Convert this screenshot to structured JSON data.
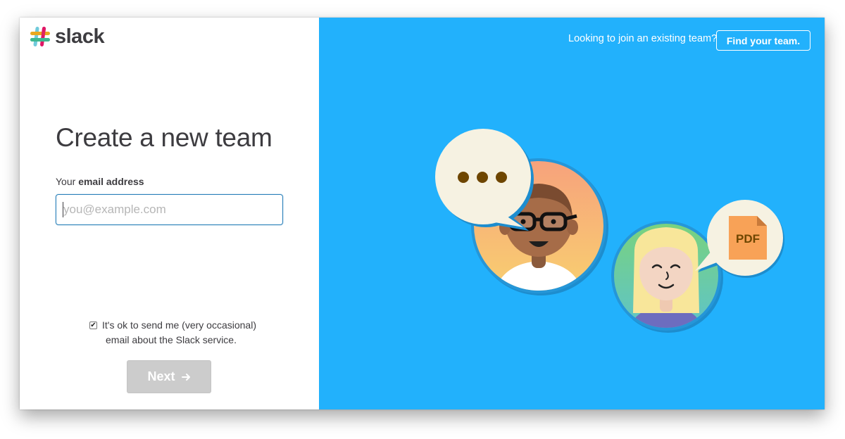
{
  "brand": {
    "name": "slack"
  },
  "form": {
    "title": "Create a new team",
    "email_label_prefix": "Your ",
    "email_label_bold": "email address",
    "email_placeholder": "you@example.com",
    "email_value": "",
    "optin_line1": "It's ok to send me (very occasional)",
    "optin_line2": "email about the Slack service.",
    "optin_checked": true,
    "next_label": "Next"
  },
  "header_right": {
    "join_text": "Looking to join an existing team?",
    "find_button": "Find your team."
  },
  "illustration": {
    "bubble_icon": "ellipsis-icon",
    "file_badge": "PDF"
  },
  "colors": {
    "accent_blue": "#22b1fc",
    "text_dark": "#3d3c40",
    "button_disabled": "#cccccc"
  }
}
